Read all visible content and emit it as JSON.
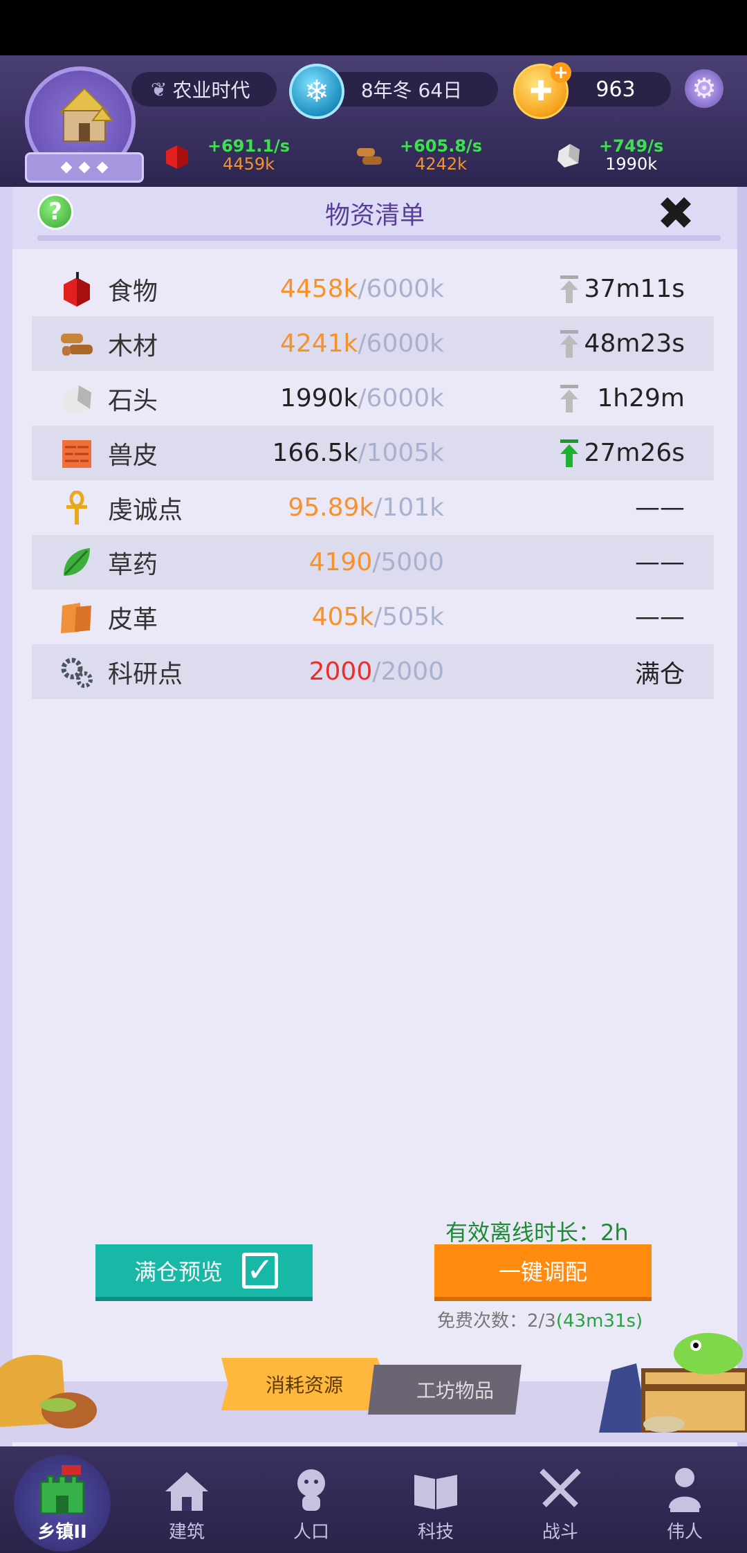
{
  "top_bar": {
    "era": "农业时代",
    "date": "8年冬 64日",
    "gems": "963",
    "resources": {
      "food": {
        "rate": "+691.1/s",
        "amount": "4459k"
      },
      "wood": {
        "rate": "+605.8/s",
        "amount": "4242k"
      },
      "stone": {
        "rate": "+749/s",
        "amount": "1990k"
      }
    }
  },
  "panel": {
    "title": "物资清单",
    "rows": [
      {
        "name": "食物",
        "current": "4458k",
        "max": "/6000k",
        "status": "37m11s",
        "current_color": "orange",
        "arrow": "gray"
      },
      {
        "name": "木材",
        "current": "4241k",
        "max": "/6000k",
        "status": "48m23s",
        "current_color": "orange",
        "arrow": "gray"
      },
      {
        "name": "石头",
        "current": "1990k",
        "max": "/6000k",
        "status": "1h29m",
        "current_color": "black",
        "arrow": "gray"
      },
      {
        "name": "兽皮",
        "current": "166.5k",
        "max": "/1005k",
        "status": "27m26s",
        "current_color": "black",
        "arrow": "green"
      },
      {
        "name": "虔诚点",
        "current": "95.89k",
        "max": "/101k",
        "status": "——",
        "current_color": "orange",
        "arrow": "none"
      },
      {
        "name": "草药",
        "current": "4190",
        "max": "/5000",
        "status": "——",
        "current_color": "orange",
        "arrow": "none"
      },
      {
        "name": "皮革",
        "current": "405k",
        "max": "/505k",
        "status": "——",
        "current_color": "orange",
        "arrow": "none"
      },
      {
        "name": "科研点",
        "current": "2000",
        "max": "/2000",
        "status": "满仓",
        "current_color": "red",
        "arrow": "none"
      }
    ],
    "offline_label": "有效离线时长：2h",
    "preview_button": "满仓预览",
    "allocate_button": "一键调配",
    "free_count_label": "免费次数：2/3",
    "free_count_countdown": "(43m31s)",
    "tabs": {
      "consume": "消耗资源",
      "workshop": "工坊物品"
    }
  },
  "nav": [
    {
      "label": "乡镇II",
      "icon": "castle-icon"
    },
    {
      "label": "建筑",
      "icon": "house-icon"
    },
    {
      "label": "人口",
      "icon": "person-icon"
    },
    {
      "label": "科技",
      "icon": "book-icon"
    },
    {
      "label": "战斗",
      "icon": "crossed-swords-icon"
    },
    {
      "label": "伟人",
      "icon": "bust-icon"
    }
  ],
  "colors": {
    "orange": "#f7912a",
    "red": "#ee2c2c",
    "green": "#27a243",
    "teal": "#17b8a5",
    "accent": "#ff8a10"
  }
}
